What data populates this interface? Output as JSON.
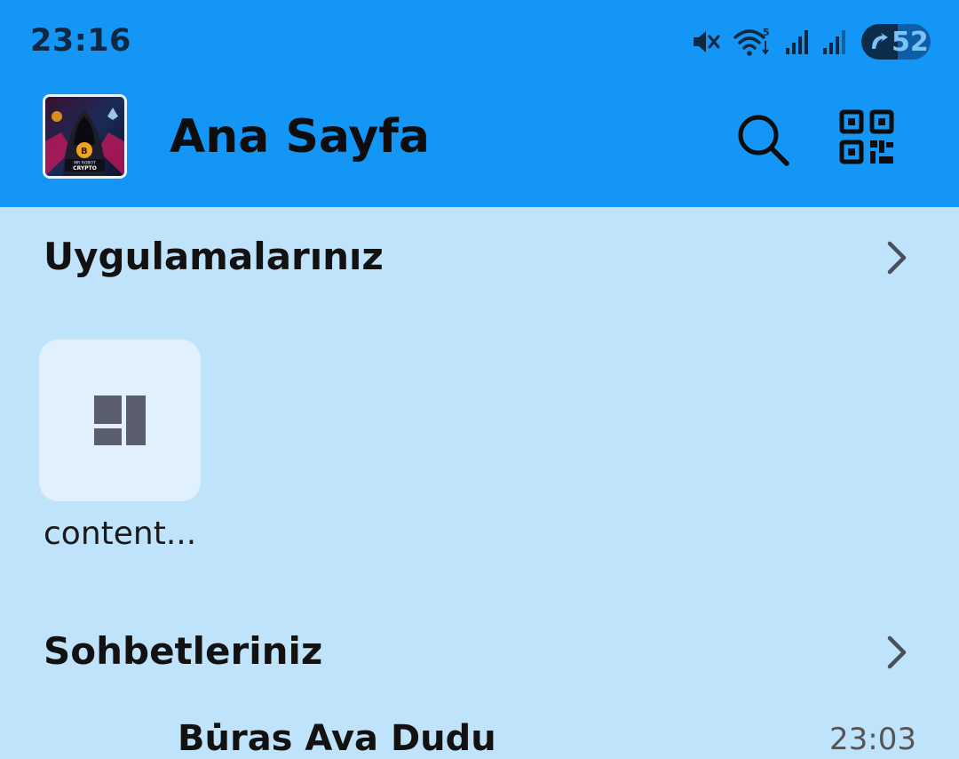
{
  "status_bar": {
    "time": "23:16",
    "battery_level": "52",
    "battery_fraction": 0.52,
    "icons": [
      "mute-icon",
      "wifi-icon",
      "signal-icon",
      "signal-icon",
      "battery-icon"
    ]
  },
  "header": {
    "title": "Ana Sayfa",
    "avatar_text": "MR ROBOT CRYPTO",
    "actions": [
      "search-icon",
      "qr-code-icon"
    ],
    "background": "#1396f5"
  },
  "apps_section": {
    "title": "Uygulamalarınız",
    "apps": [
      {
        "label": "content...",
        "icon": "layout-icon"
      }
    ]
  },
  "chats_section": {
    "title": "Sohbetleriniz",
    "first_chat": {
      "name": "Bu̇ras Ava Dudu",
      "time": "23:03"
    }
  },
  "colors": {
    "background": "#bfe3fb",
    "tile": "#e1f0fd",
    "icon_gray": "#5b5f6d"
  }
}
